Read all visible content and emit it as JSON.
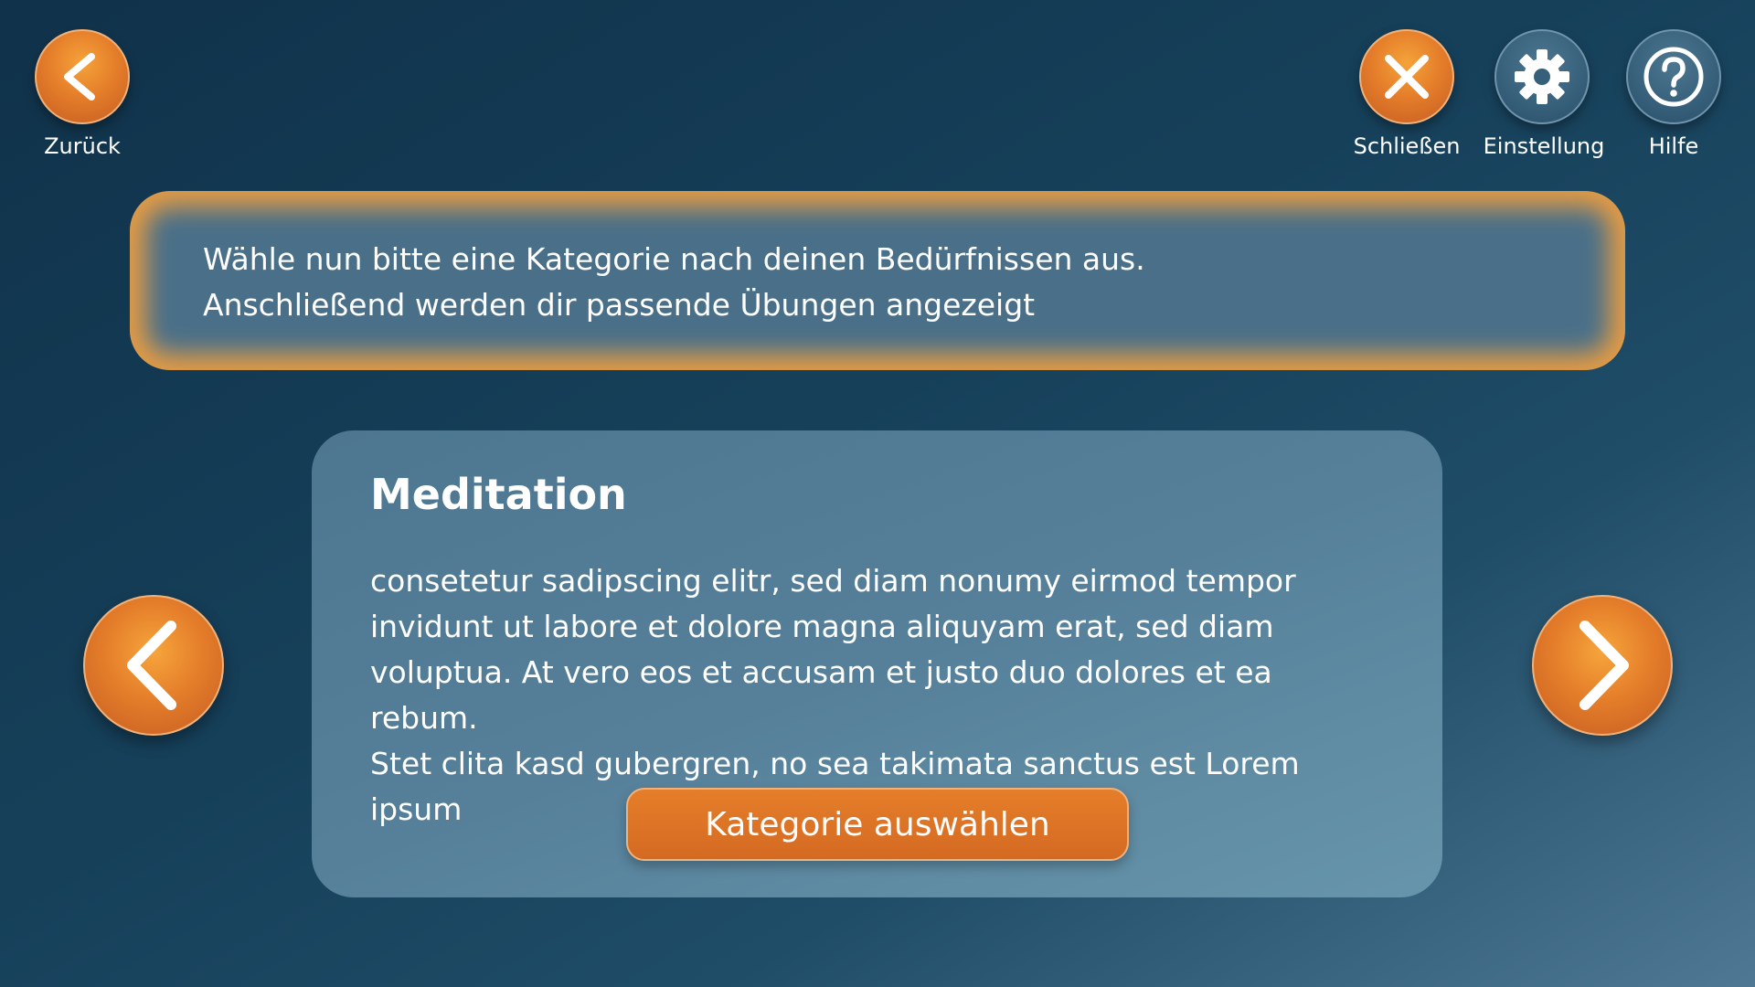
{
  "topbar": {
    "back": {
      "label": "Zurück",
      "icon": "chevron-left-icon"
    },
    "close": {
      "label": "Schließen",
      "icon": "close-icon"
    },
    "settings": {
      "label": "Einstellung",
      "icon": "gear-icon"
    },
    "help": {
      "label": "Hilfe",
      "icon": "question-mark-icon"
    }
  },
  "instruction": {
    "line1": "Wähle nun bitte eine Kategorie nach deinen Bedürfnissen aus.",
    "line2": "Anschließend werden dir passende Übungen angezeigt"
  },
  "card": {
    "title": "Meditation",
    "description_lines": [
      "consetetur sadipscing elitr, sed diam nonumy eirmod tempor",
      "invidunt ut labore et dolore magna aliquyam erat, sed diam",
      "voluptua. At vero eos et accusam et justo duo dolores et ea rebum.",
      "Stet clita kasd gubergren, no sea takimata sanctus est Lorem ipsum"
    ],
    "button_label": "Kategorie auswählen"
  },
  "carousel": {
    "prev_icon": "chevron-left-icon",
    "next_icon": "chevron-right-icon"
  },
  "colors": {
    "accent_orange": "#e57e2a",
    "background_dark": "#10324a",
    "card_blue": "#56809a"
  }
}
